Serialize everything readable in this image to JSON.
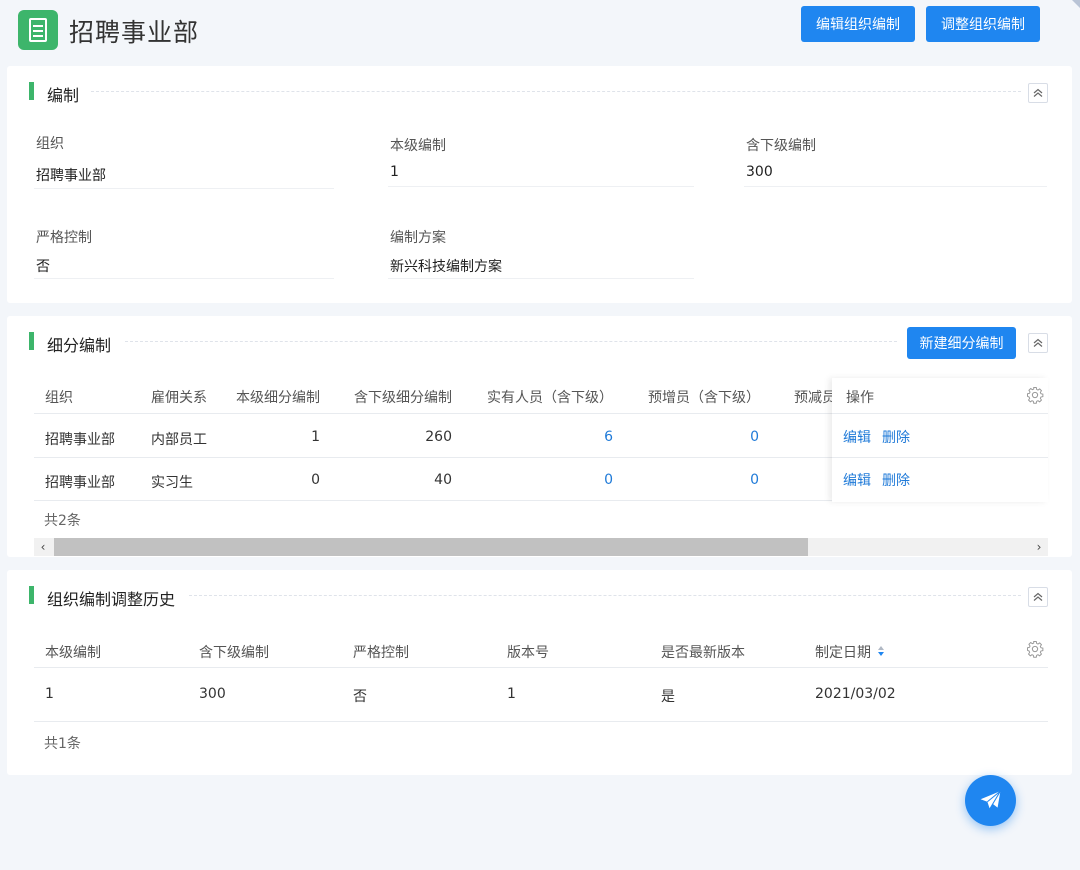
{
  "header": {
    "title": "招聘事业部",
    "edit_button": "编辑组织编制",
    "adjust_button": "调整组织编制",
    "icon": "document-icon"
  },
  "quota": {
    "title": "编制",
    "fields": [
      {
        "label": "组织",
        "value": "招聘事业部"
      },
      {
        "label": "本级编制",
        "value": "1"
      },
      {
        "label": "含下级编制",
        "value": "300"
      },
      {
        "label": "严格控制",
        "value": "否"
      },
      {
        "label": "编制方案",
        "value": "新兴科技编制方案"
      }
    ]
  },
  "sub_quota": {
    "title": "细分编制",
    "new_button": "新建细分编制",
    "columns": [
      "组织",
      "雇佣关系",
      "本级细分编制",
      "含下级细分编制",
      "实有人员（含下级）",
      "预增员（含下级）",
      "预减员",
      "操作"
    ],
    "rows": [
      {
        "org": "招聘事业部",
        "relation": "内部员工",
        "own": "1",
        "incl": "260",
        "actual": "6",
        "pre_add": "0",
        "edit": "编辑",
        "delete": "删除"
      },
      {
        "org": "招聘事业部",
        "relation": "实习生",
        "own": "0",
        "incl": "40",
        "actual": "0",
        "pre_add": "0",
        "edit": "编辑",
        "delete": "删除"
      }
    ],
    "total": "共2条"
  },
  "history": {
    "title": "组织编制调整历史",
    "columns": [
      "本级编制",
      "含下级编制",
      "严格控制",
      "版本号",
      "是否最新版本",
      "制定日期"
    ],
    "rows": [
      {
        "own": "1",
        "incl": "300",
        "strict": "否",
        "version": "1",
        "latest": "是",
        "date": "2021/03/02"
      }
    ],
    "total": "共1条"
  },
  "colors": {
    "primary": "#1f86f0",
    "accent_green": "#3db56b",
    "link": "#1f7ad8"
  },
  "icons": [
    "document-icon",
    "collapse-up-icon",
    "gear-icon",
    "sort-icon",
    "paper-plane-icon",
    "chevron-left-icon",
    "chevron-right-icon"
  ]
}
